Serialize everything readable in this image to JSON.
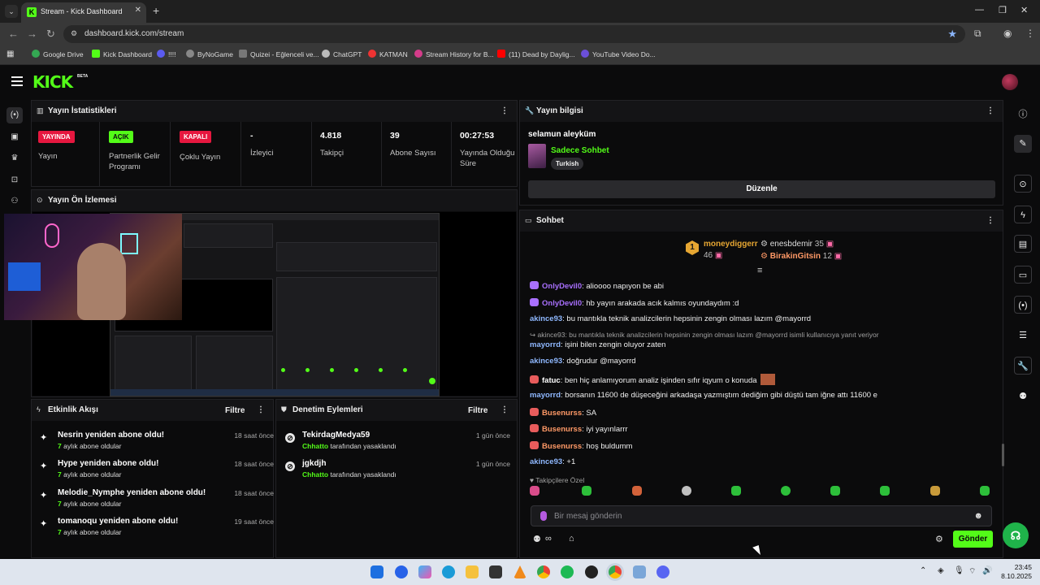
{
  "browser": {
    "tab_title": "Stream - Kick Dashboard",
    "url": "dashboard.kick.com/stream",
    "bookmarks": [
      "Google Drive",
      "Kick Dashboard",
      "!!!!",
      "ByNoGame",
      "Quizei - Eğlenceli ve...",
      "ChatGPT",
      "KATMAN",
      "Stream History for B...",
      "(11) Dead by Daylig...",
      "YouTube Video Do..."
    ]
  },
  "kick": {
    "logo": "KICK",
    "beta": "BETA"
  },
  "stats": {
    "title": "Yayın İstatistikleri",
    "cols": [
      {
        "badge": "YAYINDA",
        "label": "Yayın"
      },
      {
        "badge": "AÇIK",
        "label": "Partnerlik Gelir Programı"
      },
      {
        "badge": "KAPALI",
        "label": "Çoklu Yayın"
      },
      {
        "value": "-",
        "label": "İzleyici"
      },
      {
        "value": "4.818",
        "label": "Takipçi"
      },
      {
        "value": "39",
        "label": "Abone Sayısı"
      },
      {
        "value": "00:27:53",
        "label": "Yayında Olduğu Süre"
      }
    ]
  },
  "preview": {
    "title": "Yayın Ön İzlemesi"
  },
  "activity": {
    "title": "Etkinlik Akışı",
    "filter": "Filtre",
    "items": [
      {
        "title": "Nesrin yeniden abone oldu!",
        "months": "7",
        "sub": "aylık abone oldular",
        "time": "18 saat önce"
      },
      {
        "title": "Hype yeniden abone oldu!",
        "months": "7",
        "sub": "aylık abone oldular",
        "time": "18 saat önce"
      },
      {
        "title": "Melodie_Nymphe yeniden abone oldu!",
        "months": "7",
        "sub": "aylık abone oldular",
        "time": "18 saat önce"
      },
      {
        "title": "tomanoqu yeniden abone oldu!",
        "months": "7",
        "sub": "aylık abone oldular",
        "time": "19 saat önce"
      }
    ]
  },
  "moderation": {
    "title": "Denetim Eylemleri",
    "filter": "Filtre",
    "items": [
      {
        "user": "TekirdagMedya59",
        "mod": "Chhatto",
        "action": "tarafından yasaklandı",
        "time": "1 gün önce"
      },
      {
        "user": "jgkdjh",
        "mod": "Chhatto",
        "action": "tarafından yasaklandı",
        "time": "1 gün önce"
      }
    ]
  },
  "stream_info": {
    "title": "Yayın bilgisi",
    "stream_title": "selamun aleyküm",
    "category": "Sadece Sohbet",
    "language": "Turkish",
    "edit_label": "Düzenle"
  },
  "chat": {
    "title": "Sohbet",
    "leaderboard": [
      {
        "rank": "1",
        "name": "moneydiggerr",
        "count": "46"
      },
      {
        "name": "enesbdemir",
        "count": "35"
      },
      {
        "name": "BirakinGitsin",
        "count": "12"
      }
    ],
    "messages": [
      {
        "user": "OnlyDevil0",
        "text": ": alioooo napıyon be abi",
        "color": "#a970ff"
      },
      {
        "user": "OnlyDevil0",
        "text": ": hb yayın arakada acık kalmıs oyundaydım :d",
        "color": "#a970ff"
      },
      {
        "user": "akince93",
        "text": ": bu mantıkla teknik analizcilerin hepsinin zengin olması lazım @mayorrd",
        "color": "#8fb8ff"
      },
      {
        "reply": "↪ akince93: bu mantıkla teknik analizcilerin hepsinin zengin olması lazım @mayorrd isimli kullanıcıya yanıt veriyor"
      },
      {
        "user": "mayorrd",
        "text": ": işini bilen zengin oluyor zaten",
        "color": "#8fb8ff"
      },
      {
        "user": "akince93",
        "text": ": doğrudur @mayorrd",
        "color": "#8fb8ff"
      },
      {
        "user": "fatuc",
        "text": ": ben hiç anlamıyorum analiz işinden sıfır iqyum o konuda",
        "color": "#ffffff"
      },
      {
        "user": "mayorrd",
        "text": ": borsanın 11600 de düşeceğini arkadaşa yazmıştım dediğim gibi düştü tam iğne attı 11600 e",
        "color": "#8fb8ff"
      },
      {
        "user": "Busenurss",
        "text": ": SA",
        "color": "#ff9966"
      },
      {
        "user": "Busenurss",
        "text": ": iyi yayınlarrr",
        "color": "#ff9966"
      },
      {
        "user": "Busenurss",
        "text": ": hoş buldumm",
        "color": "#ff9966"
      },
      {
        "user": "akince93",
        "text": ": +1",
        "color": "#8fb8ff"
      }
    ],
    "follower_only": "Takipçilere Özel",
    "input_placeholder": "Bir mesaj gönderin",
    "send_label": "Gönder"
  },
  "taskbar": {
    "time": "23:45",
    "date": "8.10.2025"
  },
  "colors": {
    "kick_green": "#53fc18",
    "live_red": "#e6173f"
  }
}
